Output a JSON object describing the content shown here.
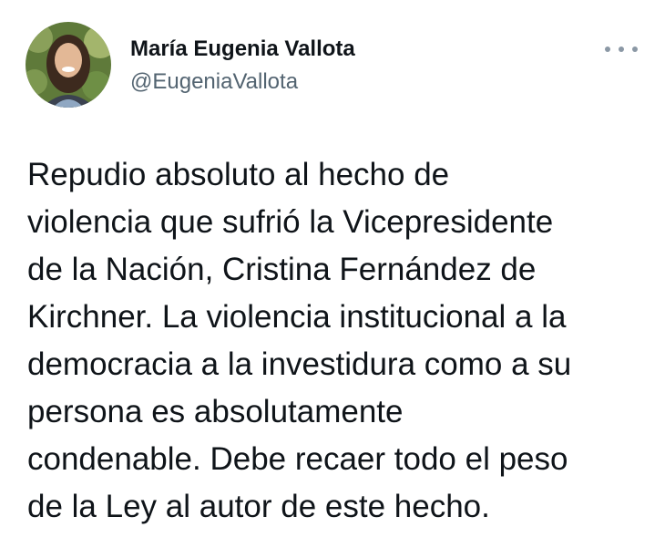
{
  "author": {
    "name": "María Eugenia Vallota",
    "handle": "@EugeniaVallota",
    "avatar_icon": "user-photo"
  },
  "more_icon": "more-horizontal-icon",
  "tweet": {
    "text": "Repudio absoluto al hecho de\nviolencia que sufrió la Vicepresidente\nde la Nación, Cristina Fernández de\nKirchner. La violencia institucional a la\ndemocracia a la investidura como a su\npersona es absolutamente\ncondenable. Debe recaer todo el peso\nde la Ley al autor de este hecho."
  },
  "colors": {
    "text": "#0f1419",
    "secondary": "#536471"
  }
}
